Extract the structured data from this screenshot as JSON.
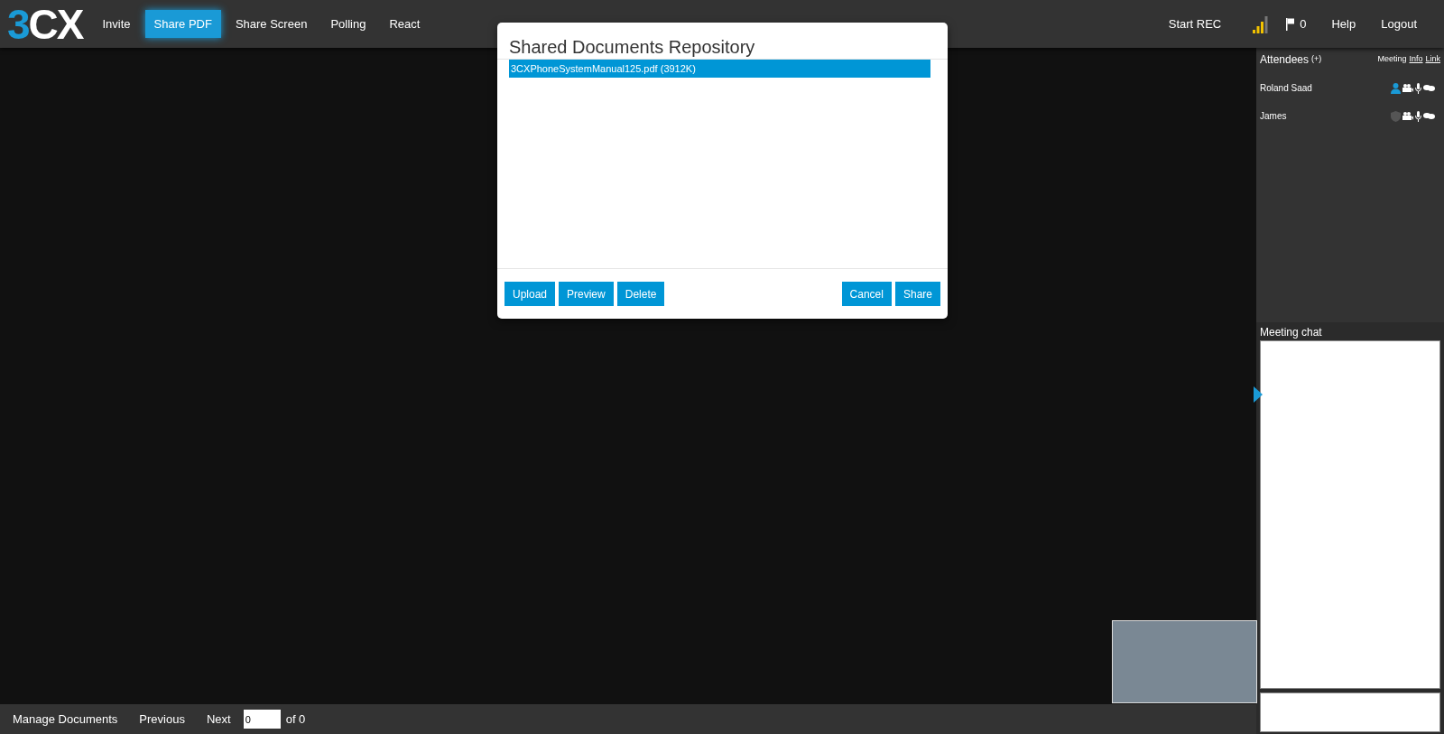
{
  "logo": {
    "text_accent": "3",
    "text_main": "CX"
  },
  "nav": [
    {
      "label": "Invite",
      "selected": false
    },
    {
      "label": "Share PDF",
      "selected": true
    },
    {
      "label": "Share Screen",
      "selected": false
    },
    {
      "label": "Polling",
      "selected": false
    },
    {
      "label": "React",
      "selected": false
    }
  ],
  "top_right": {
    "record": "Start REC",
    "flag_count": "0",
    "help": "Help",
    "logout": "Logout"
  },
  "attendees": {
    "title": "Attendees",
    "add": "(+)",
    "meeting": "Meeting",
    "info": "Info",
    "link": "Link",
    "people": [
      {
        "name": "Roland Saad",
        "kind": "host"
      },
      {
        "name": "James",
        "kind": "guest"
      }
    ]
  },
  "chat": {
    "title": "Meeting chat"
  },
  "dialog": {
    "title": "Shared Documents Repository",
    "files": [
      {
        "label": "3CXPhoneSystemManual125.pdf (3912K)",
        "selected": true
      }
    ],
    "left_buttons": [
      "Upload",
      "Preview",
      "Delete"
    ],
    "right_buttons": [
      "Cancel",
      "Share"
    ]
  },
  "bottom_bar": {
    "manage": "Manage Documents",
    "previous": "Previous",
    "next": "Next",
    "page": "0",
    "of": "of 0"
  }
}
